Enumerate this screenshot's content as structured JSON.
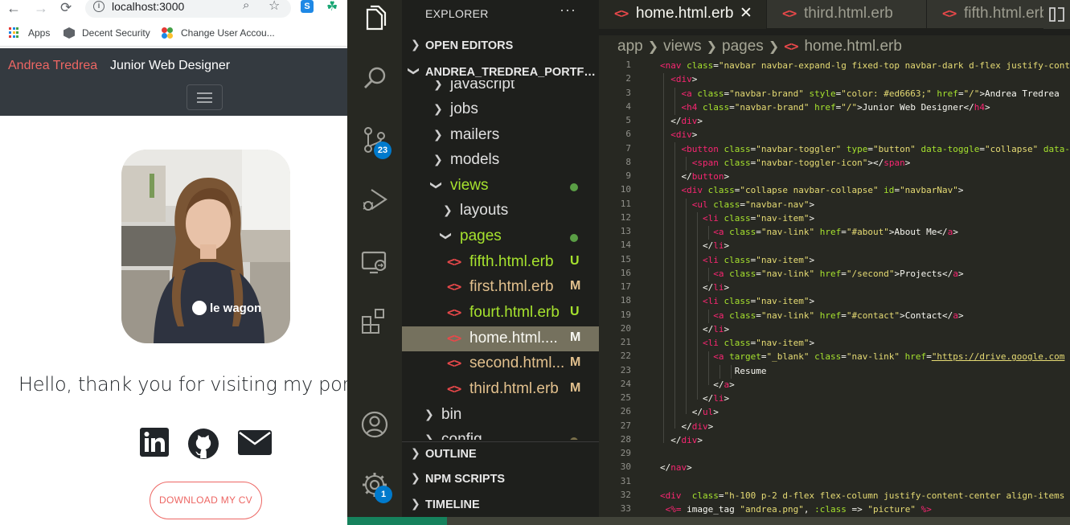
{
  "browser": {
    "url": "localhost:3000",
    "bookmarks": [
      {
        "label": "Apps"
      },
      {
        "label": "Decent Security"
      },
      {
        "label": "Change User Accou..."
      }
    ],
    "extension_label": "S"
  },
  "site": {
    "brand_name": "Andrea Tredrea",
    "brand_title": "Junior Web Designer",
    "brand_color": "#ed6663",
    "shirt_text": "le wagon",
    "greeting": "Hello, thank you for visiting my port",
    "social_icons": [
      "linkedin-icon",
      "github-icon",
      "mail-icon"
    ],
    "cv_button": "DOWNLOAD MY CV"
  },
  "activity_bar": {
    "icons": [
      "files-icon",
      "search-icon",
      "source-control-icon",
      "run-debug-icon",
      "remote-explorer-icon",
      "extensions-icon",
      "account-icon",
      "gear-icon"
    ],
    "source_control_badge": "23",
    "settings_badge": "1"
  },
  "sidebar": {
    "title": "EXPLORER",
    "more": "···",
    "open_editors": "OPEN EDITORS",
    "project": "ANDREA_TREDREA_PORTFOLIO",
    "tree": [
      {
        "name": "javascript",
        "type": "folder"
      },
      {
        "name": "jobs",
        "type": "folder"
      },
      {
        "name": "mailers",
        "type": "folder"
      },
      {
        "name": "models",
        "type": "folder"
      },
      {
        "name": "views",
        "type": "folder-open"
      },
      {
        "name": "layouts",
        "type": "folder"
      },
      {
        "name": "pages",
        "type": "folder-open"
      },
      {
        "name": "fifth.html.erb",
        "status": "U"
      },
      {
        "name": "first.html.erb",
        "status": "M"
      },
      {
        "name": "fourt.html.erb",
        "status": "U"
      },
      {
        "name": "home.html....",
        "status": "M"
      },
      {
        "name": "second.html...",
        "status": "M"
      },
      {
        "name": "third.html.erb",
        "status": "M"
      },
      {
        "name": "bin",
        "type": "folder"
      },
      {
        "name": "config",
        "type": "folder"
      }
    ],
    "outline": "OUTLINE",
    "npm_scripts": "NPM SCRIPTS",
    "timeline": "TIMELINE"
  },
  "editor": {
    "tabs": [
      {
        "label": "home.html.erb",
        "active": true
      },
      {
        "label": "third.html.erb",
        "active": false
      },
      {
        "label": "fifth.html.erb",
        "active": false
      }
    ],
    "breadcrumb": [
      "app",
      "views",
      "pages",
      "home.html.erb"
    ],
    "line_numbers": [
      "1",
      "2",
      "3",
      "4",
      "5",
      "6",
      "7",
      "8",
      "9",
      "10",
      "11",
      "12",
      "13",
      "14",
      "15",
      "16",
      "17",
      "18",
      "19",
      "20",
      "21",
      "22",
      "23",
      "24",
      "25",
      "26",
      "27",
      "28",
      "29",
      "30",
      "31",
      "32",
      "33"
    ]
  },
  "colors": {
    "accent_red": "#ed6663",
    "navbar_dark": "#343a40",
    "badge_blue": "#007acc",
    "selection": "#75715e"
  }
}
